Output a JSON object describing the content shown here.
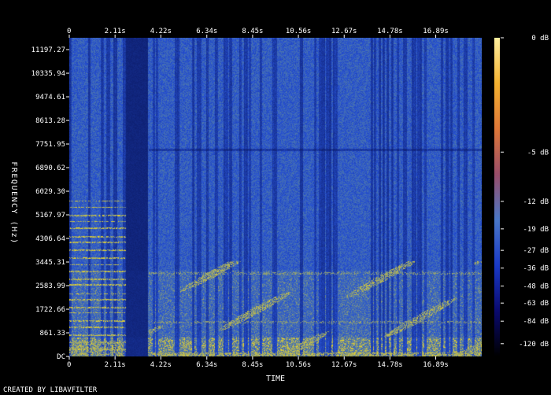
{
  "chart_data": {
    "type": "heatmap",
    "title": "",
    "xlabel": "TIME",
    "ylabel": "FREQUENCY (Hz)",
    "x_unit": "s",
    "xlim": [
      0,
      19.01
    ],
    "ylim": [
      0,
      11628.9
    ],
    "x_ticks": [
      0,
      2.11,
      4.22,
      6.34,
      8.45,
      10.56,
      12.67,
      14.78,
      16.89
    ],
    "x_tick_labels": [
      "0",
      "2.11s",
      "4.22s",
      "6.34s",
      "8.45s",
      "10.56s",
      "12.67s",
      "14.78s",
      "16.89s"
    ],
    "y_ticks": [
      0,
      861.33,
      1722.66,
      2583.99,
      3445.31,
      4306.64,
      5167.97,
      6029.3,
      6890.62,
      7751.95,
      8613.28,
      9474.61,
      10335.94,
      11197.27
    ],
    "y_tick_labels": [
      "DC",
      "861.33",
      "1722.66",
      "2583.99",
      "3445.31",
      "4306.64",
      "5167.97",
      "6029.30",
      "6890.62",
      "7751.95",
      "8613.28",
      "9474.61",
      "10335.94",
      "11197.27"
    ],
    "colorbar": {
      "ticks": [
        0,
        -5,
        -12,
        -19,
        -27,
        -36,
        -48,
        -63,
        -84,
        -120
      ],
      "tick_labels": [
        "0 dB",
        "-5 dB",
        "-12 dB",
        "-19 dB",
        "-27 dB",
        "-36 dB",
        "-48 dB",
        "-63 dB",
        "-84 dB",
        "-120 dB"
      ],
      "colors_top_to_bottom": [
        "#fff0a0",
        "#f4b230",
        "#e07838",
        "#9a4e6a",
        "#4a78c8",
        "#1a3ac8",
        "#0a0a70",
        "#000000"
      ]
    },
    "grid": false
  },
  "footer": {
    "credit": "CREATED BY LIBAVFILTER"
  }
}
